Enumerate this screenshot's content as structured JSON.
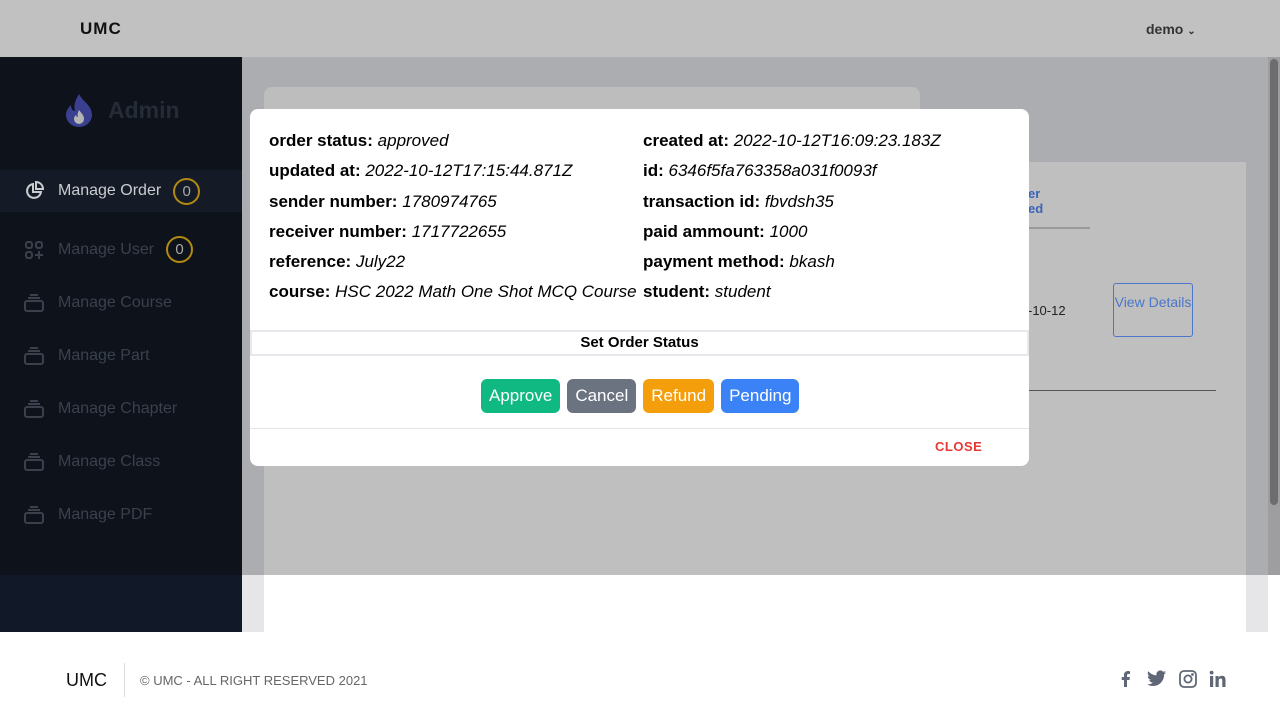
{
  "header": {
    "brand": "UMC",
    "user": "demo"
  },
  "sidebar": {
    "title": "Admin",
    "items": [
      {
        "label": "Manage Order",
        "badge": "0",
        "icon": "pie-chart-icon"
      },
      {
        "label": "Manage User",
        "badge": "0",
        "icon": "apps-add-icon"
      },
      {
        "label": "Manage Course",
        "icon": "stack-icon"
      },
      {
        "label": "Manage Part",
        "icon": "stack-icon"
      },
      {
        "label": "Manage Chapter",
        "icon": "stack-icon"
      },
      {
        "label": "Manage Class",
        "icon": "stack-icon"
      },
      {
        "label": "Manage PDF",
        "icon": "stack-icon"
      }
    ]
  },
  "background": {
    "header_partial_1": "er",
    "header_partial_2": "ed",
    "date_partial": "-10-12",
    "view_details": "View Details"
  },
  "modal": {
    "fields": [
      {
        "label": "order status:",
        "value": "approved"
      },
      {
        "label": "created at:",
        "value": "2022-10-12T16:09:23.183Z"
      },
      {
        "label": "updated at:",
        "value": "2022-10-12T17:15:44.871Z"
      },
      {
        "label": "id:",
        "value": "6346f5fa763358a031f0093f"
      },
      {
        "label": "sender number:",
        "value": "1780974765"
      },
      {
        "label": "transaction id:",
        "value": "fbvdsh35"
      },
      {
        "label": "receiver number:",
        "value": "1717722655"
      },
      {
        "label": "paid ammount:",
        "value": "1000"
      },
      {
        "label": "reference:",
        "value": "July22"
      },
      {
        "label": "payment method:",
        "value": "bkash"
      },
      {
        "label": "course:",
        "value": "HSC 2022 Math One Shot MCQ Course"
      },
      {
        "label": "student:",
        "value": "student"
      }
    ],
    "set_status_title": "Set Order Status",
    "buttons": [
      {
        "label": "Approve",
        "color": "#10b981"
      },
      {
        "label": "Cancel",
        "color": "#6b7280"
      },
      {
        "label": "Refund",
        "color": "#f59e0b"
      },
      {
        "label": "Pending",
        "color": "#3b82f6"
      }
    ],
    "close_label": "CLOSE"
  },
  "footer": {
    "brand": "UMC",
    "copyright": "© UMC - ALL RIGHT RESERVED 2021",
    "social": [
      "facebook-icon",
      "twitter-icon",
      "instagram-icon",
      "linkedin-icon"
    ]
  }
}
